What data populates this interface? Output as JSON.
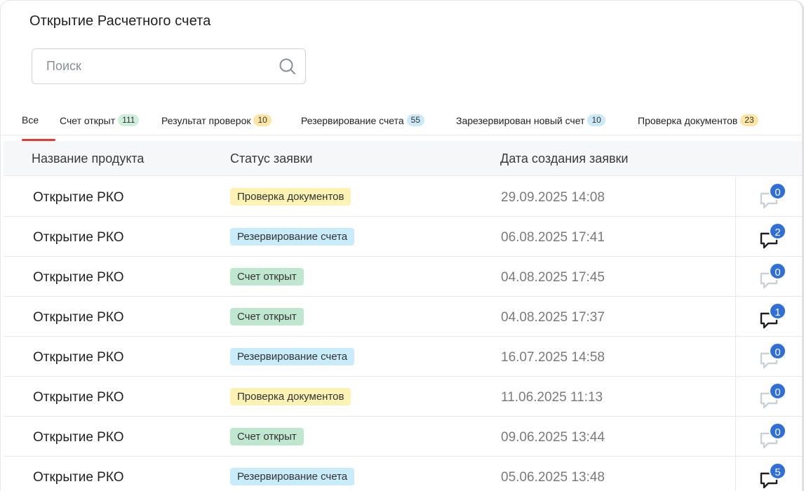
{
  "page": {
    "title": "Открытие Расчетного счета"
  },
  "search": {
    "placeholder": "Поиск",
    "value": ""
  },
  "tabs": [
    {
      "label": "Все",
      "count": null,
      "active": true
    },
    {
      "label": "Счет открыт",
      "count": "111",
      "color": "green"
    },
    {
      "label": "Результат проверок",
      "count": "10",
      "color": "yellow"
    },
    {
      "label": "Резервирование счета",
      "count": "55",
      "color": "blue"
    },
    {
      "label": "Зарезервирован новый счет",
      "count": "10",
      "color": "blue"
    },
    {
      "label": "Проверка документов",
      "count": "23",
      "color": "yellow"
    }
  ],
  "table": {
    "columns": [
      "Название продукта",
      "Статус заявки",
      "Дата создания заявки"
    ],
    "rows": [
      {
        "product": "Открытие РКО",
        "status": "Проверка документов",
        "status_color": "yellow",
        "date": "29.09.2025 14:08",
        "comments": "0",
        "comments_active": false
      },
      {
        "product": "Открытие РКО",
        "status": "Резервирование счета",
        "status_color": "blue",
        "date": "06.08.2025 17:41",
        "comments": "2",
        "comments_active": true
      },
      {
        "product": "Открытие РКО",
        "status": "Счет открыт",
        "status_color": "green",
        "date": "04.08.2025 17:45",
        "comments": "0",
        "comments_active": false
      },
      {
        "product": "Открытие РКО",
        "status": "Счет открыт",
        "status_color": "green",
        "date": "04.08.2025 17:37",
        "comments": "1",
        "comments_active": true
      },
      {
        "product": "Открытие РКО",
        "status": "Резервирование счета",
        "status_color": "blue",
        "date": "16.07.2025 14:58",
        "comments": "0",
        "comments_active": false
      },
      {
        "product": "Открытие РКО",
        "status": "Проверка документов",
        "status_color": "yellow",
        "date": "11.06.2025 11:13",
        "comments": "0",
        "comments_active": false
      },
      {
        "product": "Открытие РКО",
        "status": "Счет открыт",
        "status_color": "green",
        "date": "09.06.2025 13:44",
        "comments": "0",
        "comments_active": false
      },
      {
        "product": "Открытие РКО",
        "status": "Резервирование счета",
        "status_color": "blue",
        "date": "05.06.2025 13:48",
        "comments": "5",
        "comments_active": true
      }
    ]
  },
  "colors": {
    "accent_underline": "#e53935",
    "comment_badge": "#2f6fd6",
    "status_yellow": "#fcf2b4",
    "status_blue": "#c9ecfa",
    "status_green": "#bfe6cf"
  },
  "icons": {
    "search": "search-icon",
    "comment": "chat-bubble-icon"
  }
}
